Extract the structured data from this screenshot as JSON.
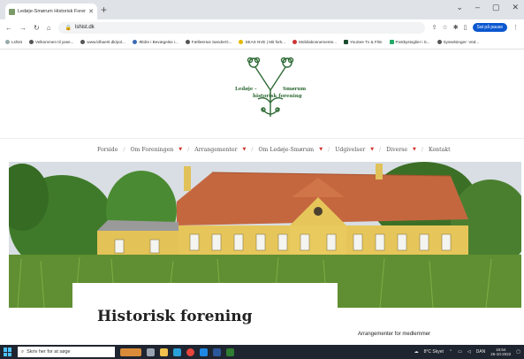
{
  "browser": {
    "tab_title": "Ledøje-Smørum Historisk Foren",
    "new_tab": "+",
    "window_controls": [
      "⌄",
      "–",
      "▢",
      "✕"
    ],
    "url": "lshist.dk",
    "profile_label": "Sat på pause"
  },
  "bookmarks": [
    "Lshist",
    "Velkommen til yase...",
    "www.ldhaerit.dk/pol...",
    "Ældre i Bevægelse i...",
    "FællesHus SønderO...",
    "SEAS NVE | Mit fork...",
    "Mobilabonnemente...",
    "YouSee Tv & Film",
    "Postkystoglier i S...",
    "Sysselsinger- Ved..."
  ],
  "logo": {
    "word_left": "Ledøje -",
    "word_right": "Smørum",
    "word_bottom": "historisk forening"
  },
  "nav": [
    {
      "label": "Forside",
      "dropdown": false
    },
    {
      "label": "Om Foreningen",
      "dropdown": true
    },
    {
      "label": "Arrangementer",
      "dropdown": true
    },
    {
      "label": "Om Ledøje-Smørum",
      "dropdown": true
    },
    {
      "label": "Udgivelser",
      "dropdown": true
    },
    {
      "label": "Diverse",
      "dropdown": true
    },
    {
      "label": "Kontakt",
      "dropdown": false
    }
  ],
  "page": {
    "title": "Historisk forening",
    "sidebar_heading": "Arrangementer for medlemmer"
  },
  "taskbar": {
    "search_placeholder": "Skriv her for at søge",
    "weather": "8°C Skyet",
    "language": "DAN",
    "time": "16:54",
    "date": "26-10-2022"
  },
  "colors": {
    "logo_green": "#2d6a34",
    "nav_caret": "#d0312d",
    "taskbar": "#1f2530",
    "house_wall": "#e6c65a",
    "roof": "#c4673f"
  }
}
